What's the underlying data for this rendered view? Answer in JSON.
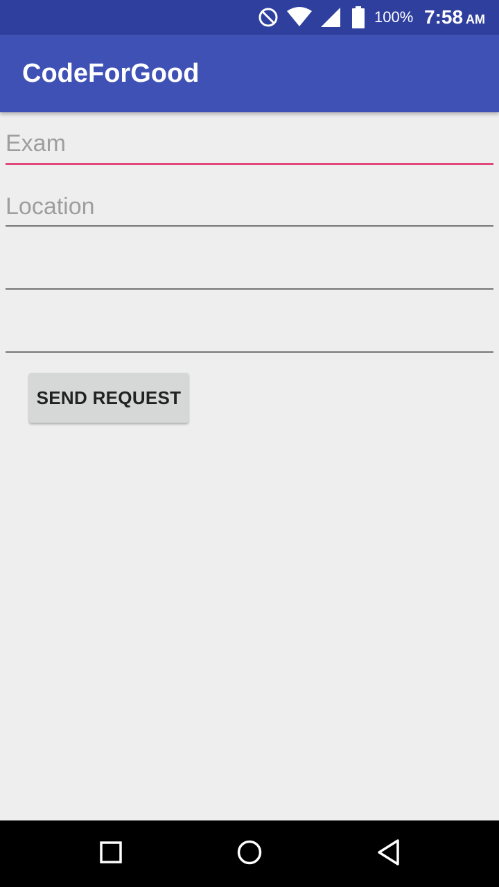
{
  "status_bar": {
    "icons": [
      "do-not-disturb-icon",
      "wifi-icon",
      "cell-signal-icon",
      "battery-icon"
    ],
    "battery": "100%",
    "time": "7:58",
    "ampm": "AM",
    "color": "#2f3f9e"
  },
  "app_bar": {
    "title": "CodeForGood",
    "color": "#3f51b5"
  },
  "form": {
    "exam": {
      "placeholder": "Exam",
      "value": ""
    },
    "location": {
      "placeholder": "Location",
      "value": ""
    },
    "field3": {
      "placeholder": "",
      "value": ""
    },
    "field4": {
      "placeholder": "",
      "value": ""
    },
    "accent_color": "#e0487a",
    "send_label": "SEND REQUEST"
  },
  "nav_bar": {
    "icons": [
      "recent-apps-icon",
      "home-icon",
      "back-icon"
    ]
  }
}
